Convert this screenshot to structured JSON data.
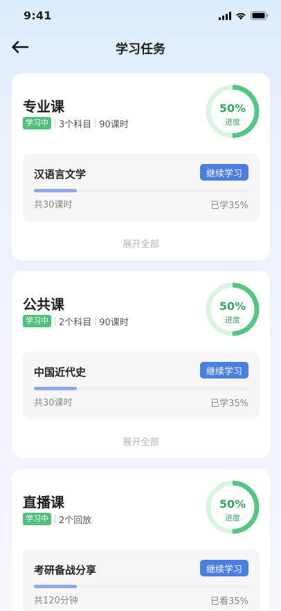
{
  "status_bar": {
    "time": "9:41"
  },
  "nav": {
    "title": "学习任务",
    "back_icon": "arrow-left-icon"
  },
  "colors": {
    "accent": "#4a7ee3",
    "green": "#4fc17d",
    "ring_light": "#d9f4e1",
    "ring_dark": "#54c683",
    "progress": "#8ea9e6"
  },
  "cards": [
    {
      "title": "专业课",
      "badge": "学习中",
      "meta": [
        "3个科目",
        "90课时"
      ],
      "ring": {
        "percent": "50%",
        "label": "进度",
        "value": 0.5
      },
      "course": {
        "name": "汉语言文学",
        "button": "继续学习",
        "left": "共30课时",
        "right": "已学35%",
        "progress": 0.2
      },
      "expand": "展开全部"
    },
    {
      "title": "公共课",
      "badge": "学习中",
      "meta": [
        "2个科目",
        "90课时"
      ],
      "ring": {
        "percent": "50%",
        "label": "进度",
        "value": 0.5
      },
      "course": {
        "name": "中国近代史",
        "button": "继续学习",
        "left": "共30课时",
        "right": "已学35%",
        "progress": 0.2
      },
      "expand": "展开全部"
    },
    {
      "title": "直播课",
      "badge": "学习中",
      "meta": [
        "2个回放"
      ],
      "ring": {
        "percent": "50%",
        "label": "进度",
        "value": 0.5
      },
      "course": {
        "name": "考研备战分享",
        "button": "继续学习",
        "left": "共120分钟",
        "right": "已看35%",
        "progress": 0.2
      }
    }
  ]
}
